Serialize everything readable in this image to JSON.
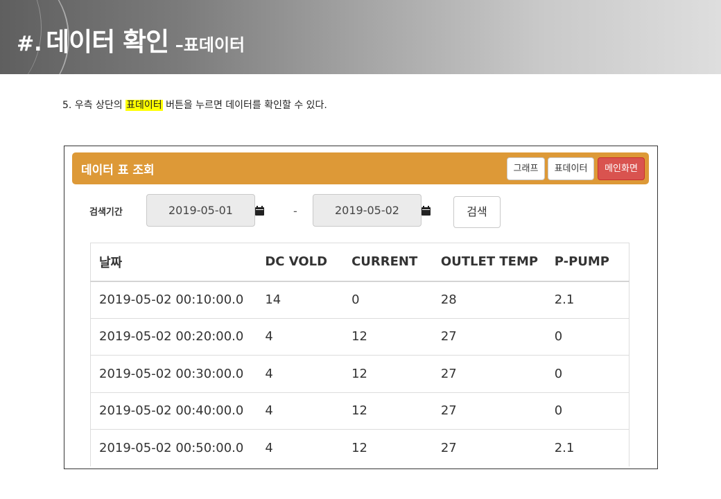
{
  "slide": {
    "hash": "#.",
    "title": "데이터 확인",
    "subtitle": "–표데이터"
  },
  "instruction": {
    "before": "5. 우측 상단의 ",
    "highlight": "표데이터",
    "after": " 버튼을 누르면 데이터를 확인할 수 있다."
  },
  "panel": {
    "title": "데이터 표 조회",
    "buttons": {
      "graph": "그래프",
      "table": "표데이터",
      "main": "메인화면"
    }
  },
  "search": {
    "label": "검색기간",
    "start_date": "2019-05-01",
    "end_date": "2019-05-02",
    "separator": "-",
    "button": "검색"
  },
  "table": {
    "headers": [
      "날짜",
      "DC VOLD",
      "CURRENT",
      "OUTLET TEMP",
      "P-PUMP"
    ],
    "rows": [
      [
        "2019-05-02 00:10:00.0",
        "14",
        "0",
        "28",
        "2.1"
      ],
      [
        "2019-05-02 00:20:00.0",
        "4",
        "12",
        "27",
        "0"
      ],
      [
        "2019-05-02 00:30:00.0",
        "4",
        "12",
        "27",
        "0"
      ],
      [
        "2019-05-02 00:40:00.0",
        "4",
        "12",
        "27",
        "0"
      ],
      [
        "2019-05-02 00:50:00.0",
        "4",
        "12",
        "27",
        "2.1"
      ]
    ]
  },
  "colors": {
    "panel_header": "#dd9937",
    "main_button": "#d9534f",
    "highlight": "#ffff00"
  },
  "icons": {
    "calendar": "calendar-icon"
  }
}
